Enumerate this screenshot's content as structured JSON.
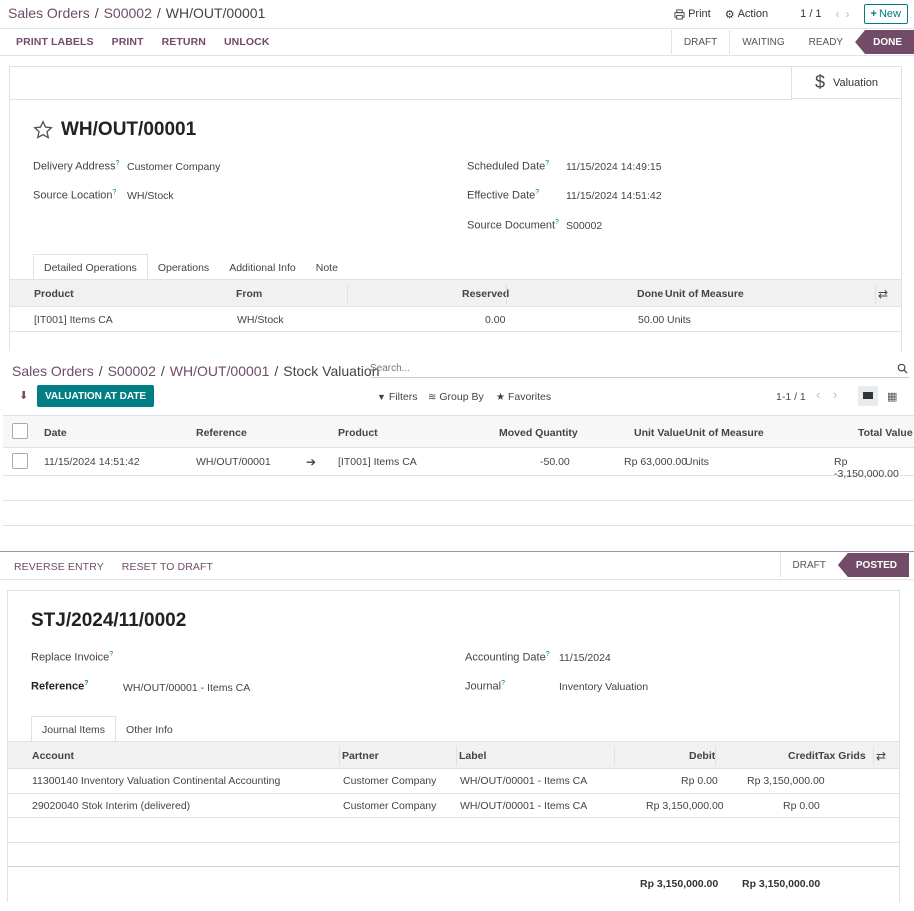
{
  "s1": {
    "breadcrumb": [
      "Sales Orders",
      "S00002",
      "WH/OUT/00001"
    ],
    "print": "Print",
    "action": "Action",
    "pager": "1 / 1",
    "new": "New",
    "buttons": [
      "PRINT LABELS",
      "PRINT",
      "RETURN",
      "UNLOCK"
    ],
    "status": [
      "DRAFT",
      "WAITING",
      "READY",
      "DONE"
    ],
    "valuation": "Valuation",
    "title": "WH/OUT/00001",
    "fields": {
      "delivery_label": "Delivery Address",
      "delivery_value": "Customer Company",
      "source_loc_label": "Source Location",
      "source_loc_value": "WH/Stock",
      "sched_label": "Scheduled Date",
      "sched_value": "11/15/2024 14:49:15",
      "eff_label": "Effective Date",
      "eff_value": "11/15/2024 14:51:42",
      "srcdoc_label": "Source Document",
      "srcdoc_value": "S00002"
    },
    "tabs": [
      "Detailed Operations",
      "Operations",
      "Additional Info",
      "Note"
    ],
    "columns": {
      "product": "Product",
      "from": "From",
      "reserved": "Reserved",
      "done": "Done",
      "uom": "Unit of Measure"
    },
    "row": {
      "product": "[IT001] Items CA",
      "from": "WH/Stock",
      "reserved": "0.00",
      "done": "50.00",
      "uom": "Units"
    }
  },
  "s2": {
    "breadcrumb": [
      "Sales Orders",
      "S00002",
      "WH/OUT/00001",
      "Stock Valuation"
    ],
    "search_placeholder": "Search...",
    "valuation_btn": "VALUATION AT DATE",
    "filters": "Filters",
    "groupby": "Group By",
    "favorites": "Favorites",
    "pager": "1-1 / 1",
    "columns": {
      "date": "Date",
      "reference": "Reference",
      "product": "Product",
      "moved": "Moved Quantity",
      "unit_value": "Unit Value",
      "uom": "Unit of Measure",
      "total": "Total Value"
    },
    "row": {
      "date": "11/15/2024 14:51:42",
      "reference": "WH/OUT/00001",
      "product": "[IT001] Items CA",
      "moved": "-50.00",
      "unit_value": "Rp 63,000.00",
      "uom": "Units",
      "total": "Rp -3,150,000.00"
    }
  },
  "s3": {
    "buttons": [
      "REVERSE ENTRY",
      "RESET TO DRAFT"
    ],
    "status": [
      "DRAFT",
      "POSTED"
    ],
    "title": "STJ/2024/11/0002",
    "fields": {
      "replace_label": "Replace Invoice",
      "ref_label": "Reference",
      "ref_value": "WH/OUT/00001 - Items CA",
      "acc_date_label": "Accounting Date",
      "acc_date_value": "11/15/2024",
      "journal_label": "Journal",
      "journal_value": "Inventory Valuation"
    },
    "tabs": [
      "Journal Items",
      "Other Info"
    ],
    "columns": {
      "account": "Account",
      "partner": "Partner",
      "label": "Label",
      "debit": "Debit",
      "credit": "Credit",
      "tax": "Tax Grids"
    },
    "rows": [
      {
        "account": "11300140 Inventory Valuation Continental Accounting",
        "partner": "Customer Company",
        "label": "WH/OUT/00001 - Items CA",
        "debit": "Rp 0.00",
        "credit": "Rp 3,150,000.00"
      },
      {
        "account": "29020040 Stok Interim (delivered)",
        "partner": "Customer Company",
        "label": "WH/OUT/00001 - Items CA",
        "debit": "Rp 3,150,000.00",
        "credit": "Rp 0.00"
      }
    ],
    "total_debit": "Rp 3,150,000.00",
    "total_credit": "Rp 3,150,000.00"
  }
}
